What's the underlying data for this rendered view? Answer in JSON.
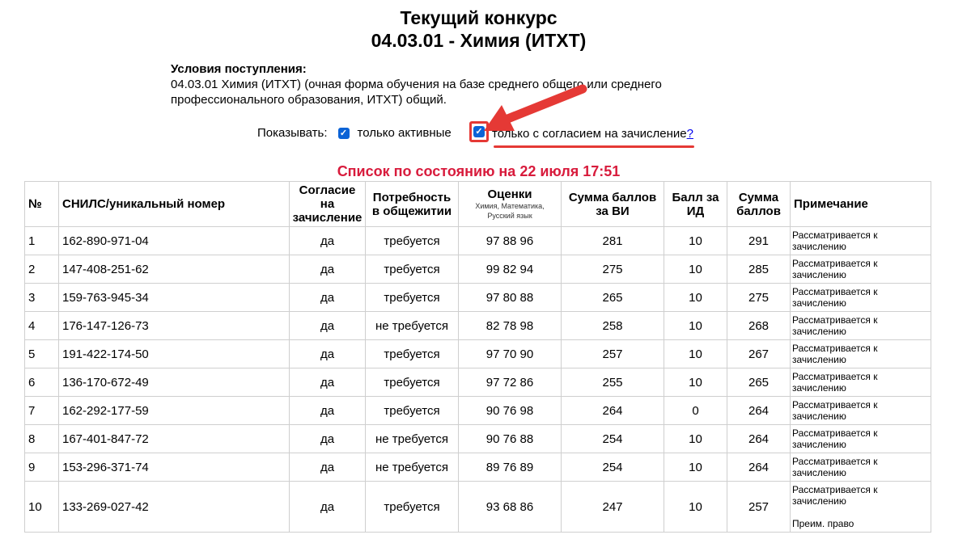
{
  "header": {
    "title_line1": "Текущий конкурс",
    "title_line2": "04.03.01 - Химия (ИТХТ)"
  },
  "conditions": {
    "heading": "Условия поступления:",
    "text": "04.03.01 Химия (ИТХТ) (очная форма обучения на базе среднего общего или среднего профессионального образования, ИТХТ) общий."
  },
  "filters": {
    "show_label": "Показывать:",
    "active_label": "только активные",
    "consent_label": "только с согласием на зачисление",
    "help_link": "?"
  },
  "status": "Список по состоянию на 22 июля 17:51",
  "table": {
    "headers": [
      "№",
      "СНИЛС/уникальный номер",
      "Согласие на зачисление",
      "Потребность в общежитии",
      "Оценки",
      "Сумма баллов за ВИ",
      "Балл за ИД",
      "Сумма баллов",
      "Примечание"
    ],
    "grades_sub": "Химия, Математика, Русский язык",
    "rows": [
      {
        "n": "1",
        "id": "162-890-971-04",
        "consent": "да",
        "dorm": "требуется",
        "grades": "97 88 96",
        "sum_vi": "281",
        "id_score": "10",
        "total": "291",
        "note": "Рассматривается к зачислению"
      },
      {
        "n": "2",
        "id": "147-408-251-62",
        "consent": "да",
        "dorm": "требуется",
        "grades": "99 82 94",
        "sum_vi": "275",
        "id_score": "10",
        "total": "285",
        "note": "Рассматривается к зачислению"
      },
      {
        "n": "3",
        "id": "159-763-945-34",
        "consent": "да",
        "dorm": "требуется",
        "grades": "97 80 88",
        "sum_vi": "265",
        "id_score": "10",
        "total": "275",
        "note": "Рассматривается к зачислению"
      },
      {
        "n": "4",
        "id": "176-147-126-73",
        "consent": "да",
        "dorm": "не требуется",
        "grades": "82 78 98",
        "sum_vi": "258",
        "id_score": "10",
        "total": "268",
        "note": "Рассматривается к зачислению"
      },
      {
        "n": "5",
        "id": "191-422-174-50",
        "consent": "да",
        "dorm": "требуется",
        "grades": "97 70 90",
        "sum_vi": "257",
        "id_score": "10",
        "total": "267",
        "note": "Рассматривается к зачислению"
      },
      {
        "n": "6",
        "id": "136-170-672-49",
        "consent": "да",
        "dorm": "требуется",
        "grades": "97 72 86",
        "sum_vi": "255",
        "id_score": "10",
        "total": "265",
        "note": "Рассматривается к зачислению"
      },
      {
        "n": "7",
        "id": "162-292-177-59",
        "consent": "да",
        "dorm": "требуется",
        "grades": "90 76 98",
        "sum_vi": "264",
        "id_score": "0",
        "total": "264",
        "note": "Рассматривается к зачислению"
      },
      {
        "n": "8",
        "id": "167-401-847-72",
        "consent": "да",
        "dorm": "не требуется",
        "grades": "90 76 88",
        "sum_vi": "254",
        "id_score": "10",
        "total": "264",
        "note": "Рассматривается к зачислению"
      },
      {
        "n": "9",
        "id": "153-296-371-74",
        "consent": "да",
        "dorm": "не требуется",
        "grades": "89 76 89",
        "sum_vi": "254",
        "id_score": "10",
        "total": "264",
        "note": "Рассматривается к зачислению"
      },
      {
        "n": "10",
        "id": "133-269-027-42",
        "consent": "да",
        "dorm": "требуется",
        "grades": "93 68 86",
        "sum_vi": "247",
        "id_score": "10",
        "total": "257",
        "note": "Рассматривается к зачислению",
        "note2": "Преим. право"
      }
    ]
  },
  "colors": {
    "highlight": "#e53935",
    "status": "#d81b3c",
    "checkbox": "#0b63d6"
  },
  "icons": {
    "checkbox": "check-icon",
    "annotation": "red-arrow-icon"
  }
}
